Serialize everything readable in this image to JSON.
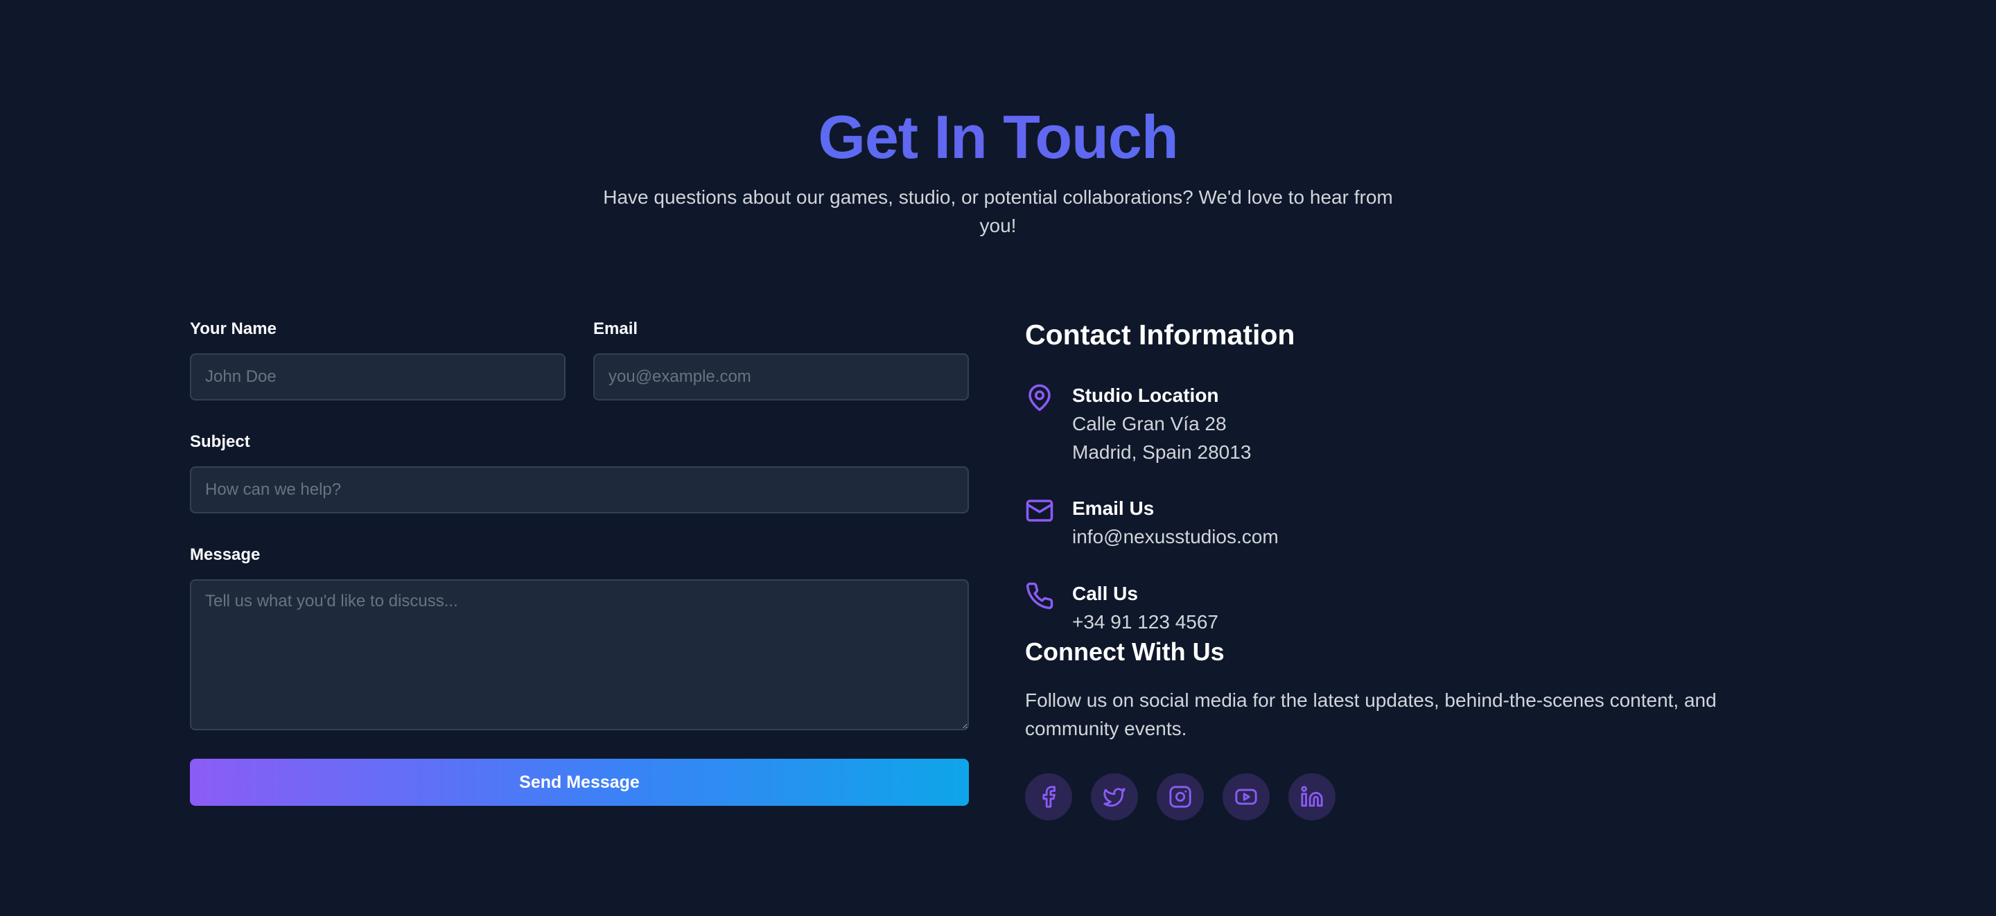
{
  "header": {
    "title": "Get In Touch",
    "subtitle": "Have questions about our games, studio, or potential collaborations? We'd love to hear from you!"
  },
  "form": {
    "name_label": "Your Name",
    "name_placeholder": "John Doe",
    "email_label": "Email",
    "email_placeholder": "you@example.com",
    "subject_label": "Subject",
    "subject_placeholder": "How can we help?",
    "message_label": "Message",
    "message_placeholder": "Tell us what you'd like to discuss...",
    "submit_label": "Send Message"
  },
  "contact": {
    "heading": "Contact Information",
    "location": {
      "icon": "map-pin-icon",
      "title": "Studio Location",
      "line1": "Calle Gran Vía 28",
      "line2": "Madrid, Spain 28013"
    },
    "email": {
      "icon": "mail-icon",
      "title": "Email Us",
      "value": "info@nexusstudios.com"
    },
    "phone": {
      "icon": "phone-icon",
      "title": "Call Us",
      "value": "+34 91 123 4567"
    }
  },
  "connect": {
    "heading": "Connect With Us",
    "text": "Follow us on social media for the latest updates, behind-the-scenes content, and community events.",
    "socials": [
      "facebook-icon",
      "twitter-icon",
      "instagram-icon",
      "youtube-icon",
      "linkedin-icon"
    ]
  },
  "colors": {
    "background": "#0f172a",
    "input_bg": "#1e293b",
    "accent_purple": "#8b5cf6",
    "accent_blue": "#3b82f6",
    "accent_cyan": "#0ea5e9"
  }
}
